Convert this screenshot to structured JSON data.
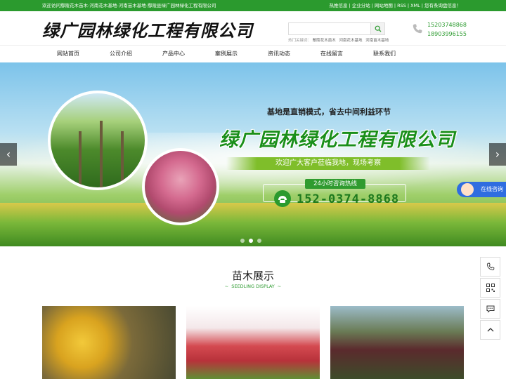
{
  "topbar": {
    "welcome": "欢迎访问鄢陵花木苗木-河南花木基地-河南苗木基地-鄢陵县绿广园林绿化工程有限公司",
    "links": [
      "热推信息",
      "企业分站",
      "网站地图",
      "RSS",
      "XML",
      "您有",
      "条询盘信息！"
    ]
  },
  "header": {
    "logo": "绿广园林绿化工程有限公司",
    "search_placeholder": "",
    "hot_label": "热门关键词：",
    "hot_keywords": [
      "鄢陵花木苗木",
      "河南花木基地",
      "河南苗木基地"
    ],
    "phones": [
      "15203748868",
      "18903996155"
    ]
  },
  "nav": [
    "网站首页",
    "公司介绍",
    "产品中心",
    "案例展示",
    "资讯动态",
    "在线留言",
    "联系我们"
  ],
  "banner": {
    "tagline": "基地是直销模式，省去中间利益环节",
    "title": "绿广园林绿化工程有限公司",
    "welcome": "欢迎广大客户莅临我地，现场考察",
    "hotline_label": "24小时咨询热线",
    "hotline_number": "152-0374-8868",
    "prev": "‹",
    "next": "›",
    "slide_count": 3,
    "active_slide": 2
  },
  "online_service": "在线咨询",
  "section": {
    "title": "苗木展示",
    "subtitle": "SEEDLING DISPLAY"
  },
  "colors": {
    "brand_green": "#2b9a2e",
    "online_blue": "#2f6de0"
  }
}
